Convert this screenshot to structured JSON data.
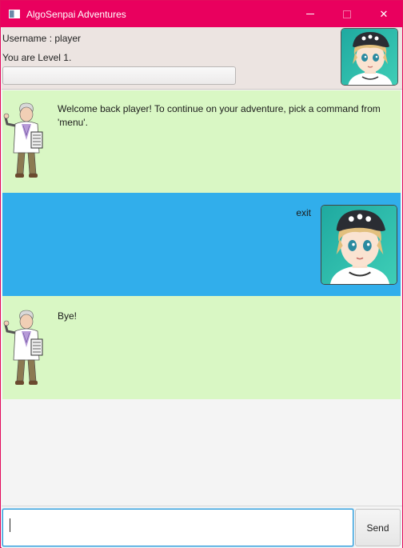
{
  "window": {
    "title": "AlgoSenpai Adventures",
    "controls": {
      "minimize": "minimize",
      "maximize": "maximize",
      "close": "✕"
    }
  },
  "header": {
    "username_text": "Username : player",
    "level_text": "You are Level 1.",
    "progress_fraction": 0
  },
  "dialogs": [
    {
      "sender": "bot",
      "text": "Welcome back player! To continue on your adventure, pick a command from 'menu'.",
      "avatar": "professor-sprite"
    },
    {
      "sender": "user",
      "text": "exit",
      "avatar": "player-avatar"
    },
    {
      "sender": "bot",
      "text": "Bye!",
      "avatar": "professor-sprite"
    }
  ],
  "input": {
    "value": "",
    "placeholder": ""
  },
  "send_label": "Send",
  "colors": {
    "titlebar": "#e9005e",
    "bot_bubble": "#d9f7c4",
    "user_bubble": "#31aeeb",
    "input_focus": "#2b9ad8"
  }
}
